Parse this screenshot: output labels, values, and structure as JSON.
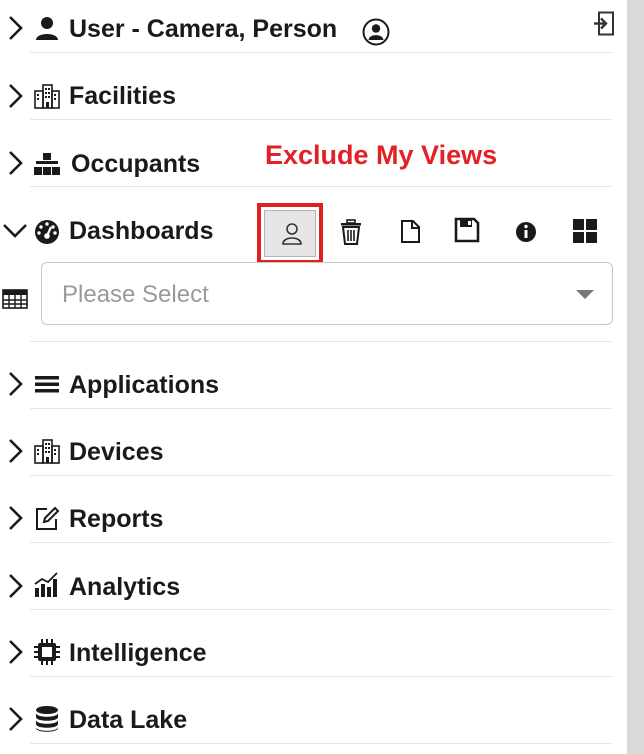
{
  "nav": {
    "user": {
      "label": "User - Camera, Person",
      "icon": "person-icon"
    },
    "items": [
      {
        "label": "Facilities",
        "icon": "building-icon",
        "expanded": false
      },
      {
        "label": "Occupants",
        "icon": "sitemap-icon",
        "expanded": false
      },
      {
        "label": "Dashboards",
        "icon": "tachometer-icon",
        "expanded": true
      },
      {
        "label": "Applications",
        "icon": "list-icon",
        "expanded": false
      },
      {
        "label": "Devices",
        "icon": "building-icon",
        "expanded": false
      },
      {
        "label": "Reports",
        "icon": "edit-icon",
        "expanded": false
      },
      {
        "label": "Analytics",
        "icon": "bar-chart-icon",
        "expanded": false
      },
      {
        "label": "Intelligence",
        "icon": "chip-icon",
        "expanded": false
      },
      {
        "label": "Data Lake",
        "icon": "database-icon",
        "expanded": false
      }
    ]
  },
  "annotation": {
    "text": "Exclude My Views",
    "color": "#e32026"
  },
  "dashboards": {
    "toolbar": [
      "exclude-my-views-icon",
      "trash-icon",
      "copy-icon",
      "save-icon",
      "info-icon",
      "grid-icon"
    ],
    "select": {
      "placeholder": "Please Select"
    }
  },
  "colors": {
    "text": "#1a1a1a",
    "annotation": "#e32026",
    "highlight_border": "#e02020",
    "divider": "#e6e6e6"
  }
}
